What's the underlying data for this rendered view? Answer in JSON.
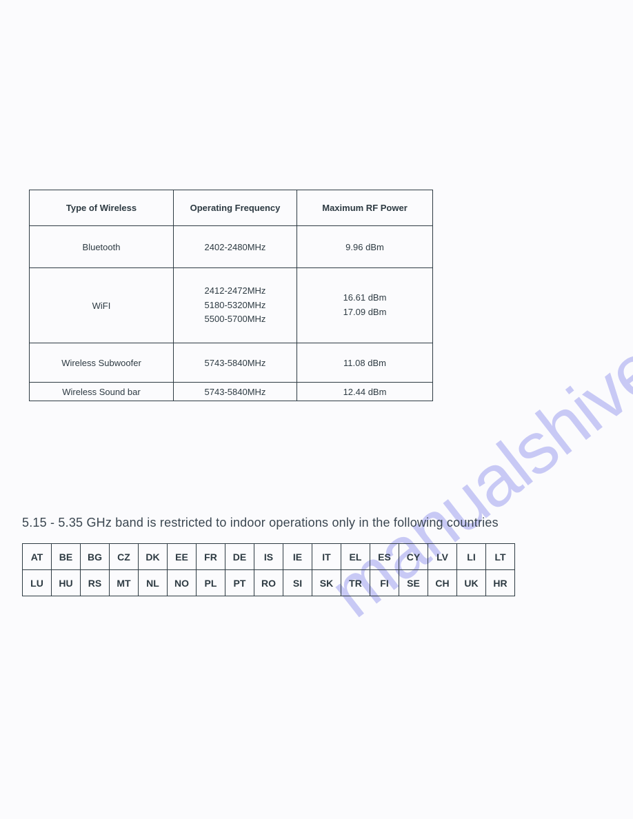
{
  "watermark": "manualshive.com",
  "wireless_table": {
    "headers": [
      "Type of Wireless",
      "Operating Frequency",
      "Maximum RF Power"
    ],
    "rows": [
      {
        "type": "Bluetooth",
        "freq": "2402-2480MHz",
        "power": "9.96 dBm"
      },
      {
        "type": "WiFI",
        "freq": "2412-2472MHz\n5180-5320MHz\n5500-5700MHz",
        "power": "16.61 dBm\n17.09 dBm"
      },
      {
        "type": "Wireless Subwoofer",
        "freq": "5743-5840MHz",
        "power": "11.08 dBm"
      },
      {
        "type": "Wireless Sound bar",
        "freq": "5743-5840MHz",
        "power": "12.44 dBm"
      }
    ]
  },
  "note": "5.15 - 5.35 GHz band is restricted to indoor operations only in the following countries",
  "countries": {
    "row1": [
      "AT",
      "BE",
      "BG",
      "CZ",
      "DK",
      "EE",
      "FR",
      "DE",
      "IS",
      "IE",
      "IT",
      "EL",
      "ES",
      "CY",
      "LV",
      "LI",
      "LT"
    ],
    "row2": [
      "LU",
      "HU",
      "RS",
      "MT",
      "NL",
      "NO",
      "PL",
      "PT",
      "RO",
      "SI",
      "SK",
      "TR",
      "FI",
      "SE",
      "CH",
      "UK",
      "HR"
    ]
  }
}
